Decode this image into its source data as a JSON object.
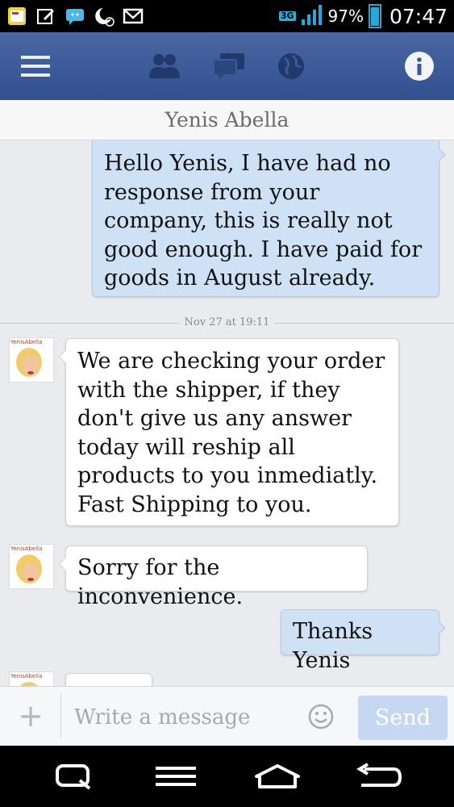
{
  "status_bar": {
    "network": "3G",
    "battery": "97%",
    "time": "07:47",
    "icons": [
      "news-app-icon",
      "edit-note-icon",
      "messenger-icon",
      "alarm-moon-icon",
      "gmail-icon",
      "signal-icon",
      "battery-icon"
    ]
  },
  "nav": {
    "icons": [
      "menu-icon",
      "friend-requests-icon",
      "messages-icon",
      "notifications-globe-icon",
      "info-icon"
    ]
  },
  "header": {
    "title": "Yenis Abella"
  },
  "messages": [
    {
      "direction": "out",
      "text": "Hello Yenis, I have had no response from your company, this is really not good enough. I have paid for goods in August already."
    },
    {
      "direction": "in",
      "text": "We are checking your order with the shipper, if they don't give us any answer today will reship all products to you inmediatly. Fast Shipping to you."
    },
    {
      "direction": "in",
      "text": "Sorry for the inconvenience."
    },
    {
      "direction": "out",
      "text": "Thanks Yenis"
    }
  ],
  "timestamp": "Nov 27 at 19:11",
  "avatar_label": "YenisAbella",
  "composer": {
    "placeholder": "Write a message",
    "send_label": "Send"
  },
  "colors": {
    "nav_blue": "#3b5998",
    "outgoing_bubble": "#cfe1f5",
    "incoming_bubble": "#ffffff",
    "send_button": "#c5d7f1"
  }
}
